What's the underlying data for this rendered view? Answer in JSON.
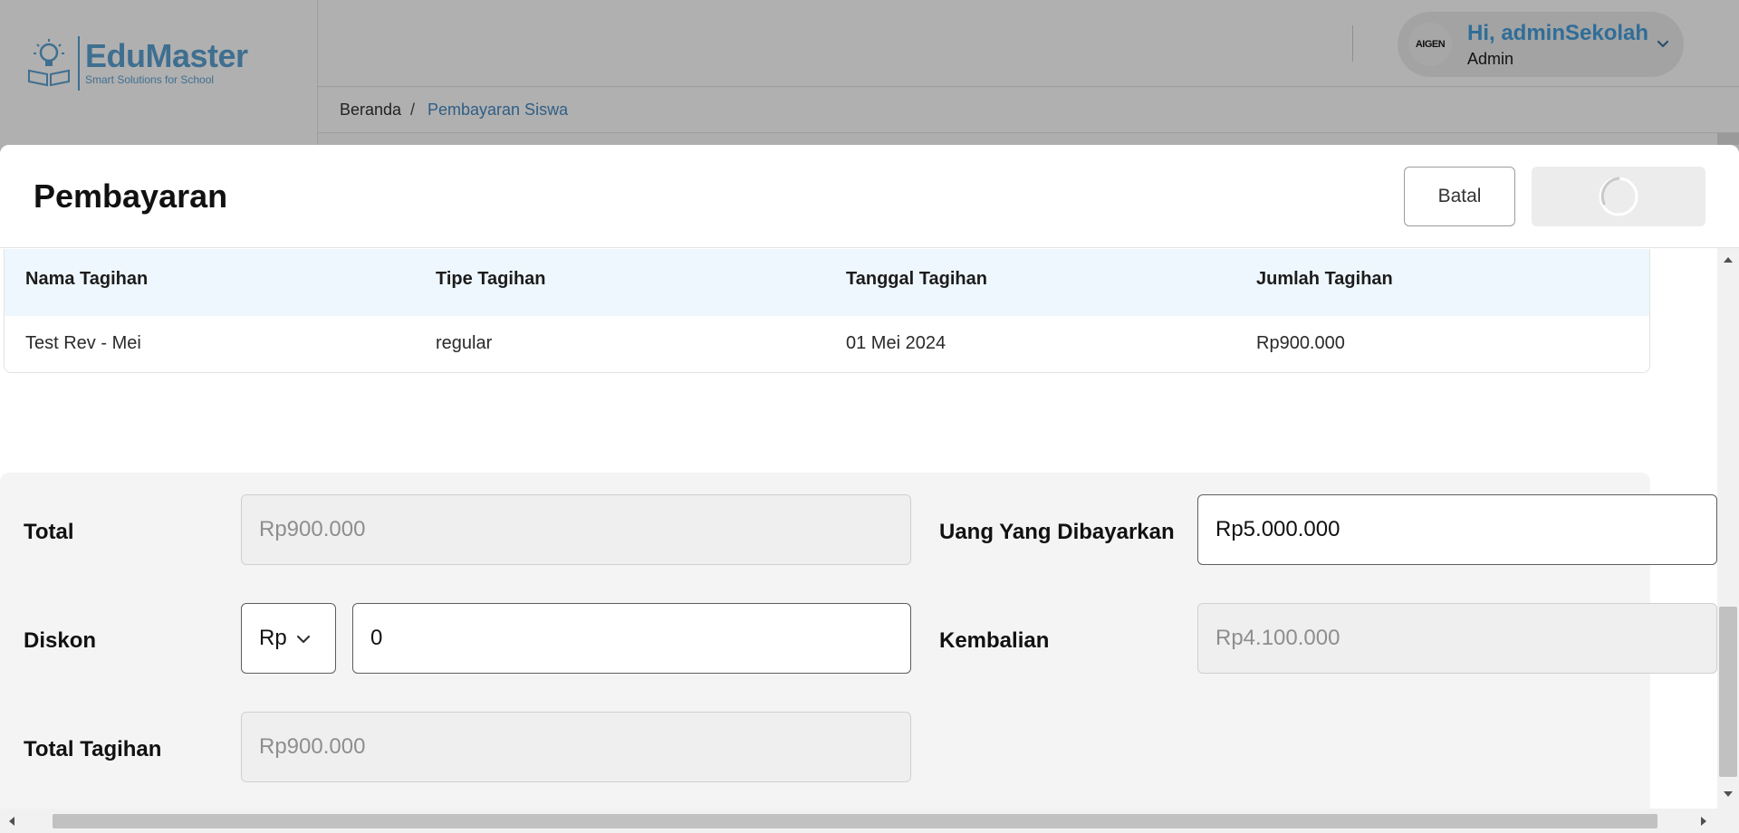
{
  "brand": {
    "name": "EduMaster",
    "tagline": "Smart Solutions for School"
  },
  "user": {
    "greeting": "Hi, adminSekolah",
    "role": "Admin",
    "avatar_text": "AIGEN"
  },
  "breadcrumb": {
    "items": [
      "Beranda",
      "Pembayaran Siswa"
    ],
    "separator": "/"
  },
  "modal": {
    "title": "Pembayaran",
    "cancel_label": "Batal",
    "submit_state": "loading"
  },
  "bill_table": {
    "columns": [
      "Nama Tagihan",
      "Tipe Tagihan",
      "Tanggal Tagihan",
      "Jumlah Tagihan"
    ],
    "rows": [
      [
        "Test Rev - Mei",
        "regular",
        "01 Mei 2024",
        "Rp900.000"
      ]
    ]
  },
  "payment_form": {
    "total_label": "Total",
    "total_value": "Rp900.000",
    "discount_label": "Diskon",
    "discount_type": "Rp",
    "discount_value": "0",
    "grand_total_label": "Total Tagihan",
    "grand_total_value": "Rp900.000",
    "paid_label": "Uang Yang Dibayarkan",
    "paid_value": "Rp5.000.000",
    "change_label": "Kembalian",
    "change_value": "Rp4.100.000"
  },
  "colors": {
    "brand": "#3f6f90",
    "table_header_bg": "#eef7fd",
    "panel_bg": "#f4f4f4",
    "link": "#2f5e86"
  }
}
